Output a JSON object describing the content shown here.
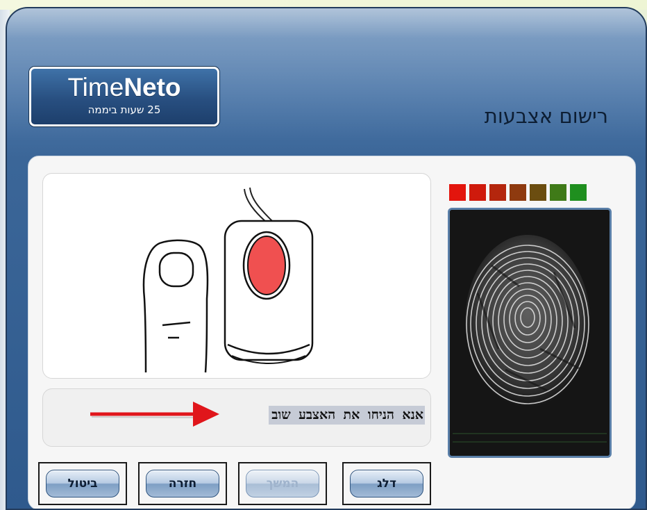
{
  "logo": {
    "brand_light": "Time",
    "brand_bold": "Neto",
    "tagline": "25 שעות ביממה"
  },
  "window": {
    "title": "רישום אצבעות"
  },
  "instruction": {
    "text": "אנא הניחו את האצבע שוב"
  },
  "quality_meter": {
    "colors": [
      "#e3150d",
      "#cf1a0c",
      "#b4260d",
      "#8e3a0f",
      "#6b4d10",
      "#3f7a18",
      "#1f8f1f"
    ]
  },
  "buttons": {
    "cancel": "ביטול",
    "back": "חזרה",
    "continue": "המשך",
    "skip": "דלג"
  },
  "icons": {
    "finger": "finger-on-scanner-illustration",
    "arrow": "red-arrow-icon"
  }
}
